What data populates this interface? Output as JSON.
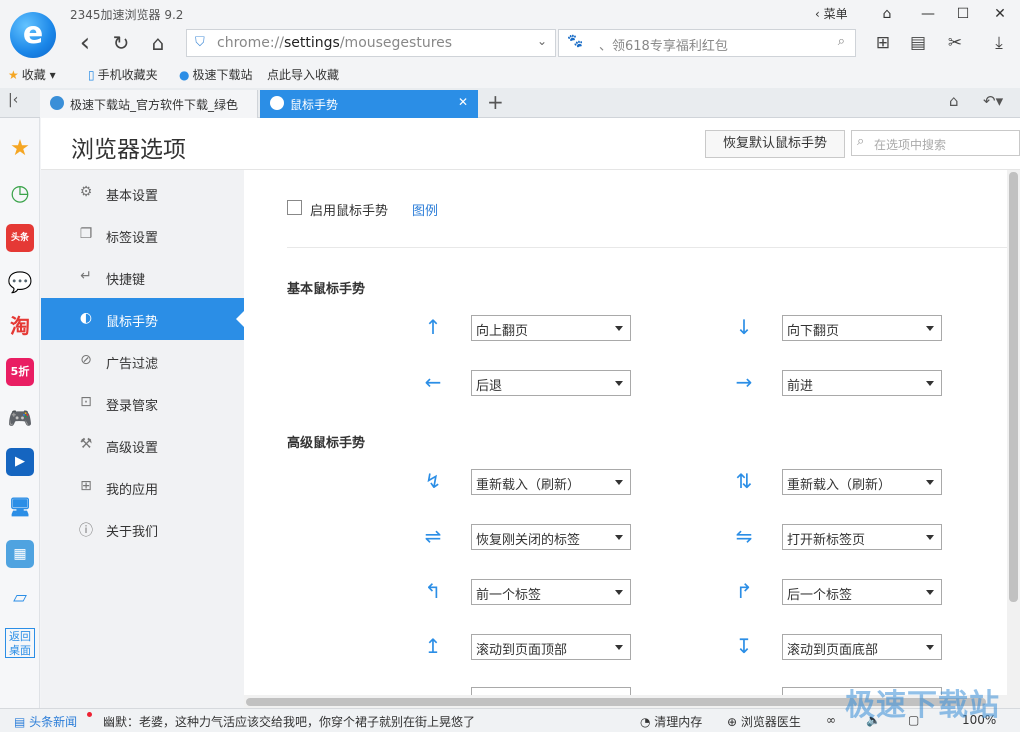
{
  "titlebar": {
    "logo_glyph": "e",
    "title": "2345加速浏览器 9.2",
    "menu_label": "菜单",
    "minimize": "—",
    "maximize": "☐",
    "close": "✕",
    "back": "‹",
    "reload": "↻",
    "home": "⌂"
  },
  "address": {
    "url_prefix": "chrome://",
    "url_host": "settings",
    "url_path": "/mousegestures",
    "search_placeholder": "、领618专享福利红包"
  },
  "bookmarks": {
    "items": [
      "收藏",
      "手机收藏夹",
      "极速下载站",
      "点此导入收藏"
    ]
  },
  "tabs": [
    {
      "label": "极速下载站_官方软件下载_绿色",
      "active": false
    },
    {
      "label": "鼠标手势",
      "active": true
    }
  ],
  "appbar": {
    "icons": [
      "star-icon",
      "clock-icon",
      "toutiao-icon",
      "wechat-icon",
      "taobao-icon",
      "discount-icon",
      "game-icon",
      "video-icon",
      "computer-icon",
      "calculator-icon",
      "notebook-icon"
    ],
    "taobao_glyph": "淘",
    "discount_glyph": "5折",
    "toutiao_glyph": "头条",
    "back_desktop": "返回桌面"
  },
  "settings": {
    "page_title": "浏览器选项",
    "reset_button": "恢复默认鼠标手势",
    "search_placeholder": "在选项中搜索",
    "nav": [
      {
        "label": "基本设置",
        "icon": "gear-icon",
        "glyph": "⚙"
      },
      {
        "label": "标签设置",
        "icon": "tab-icon",
        "glyph": "❐"
      },
      {
        "label": "快捷键",
        "icon": "keyboard-icon",
        "glyph": "↵"
      },
      {
        "label": "鼠标手势",
        "icon": "mouse-icon",
        "glyph": "◐"
      },
      {
        "label": "广告过滤",
        "icon": "block-icon",
        "glyph": "⊘"
      },
      {
        "label": "登录管家",
        "icon": "lock-icon",
        "glyph": "🔒"
      },
      {
        "label": "高级设置",
        "icon": "wrench-icon",
        "glyph": "🔧"
      },
      {
        "label": "我的应用",
        "icon": "apps-icon",
        "glyph": "⊞"
      },
      {
        "label": "关于我们",
        "icon": "info-icon",
        "glyph": "ⓘ"
      }
    ],
    "active_nav": 3,
    "enable_label": "启用鼠标手势",
    "enable_checked": false,
    "legend_link": "图例",
    "basic_title": "基本鼠标手势",
    "advanced_title": "高级鼠标手势",
    "basic_gestures": [
      {
        "arrow": "↑",
        "icon": "arrow-up-icon",
        "action": "向上翻页"
      },
      {
        "arrow": "↓",
        "icon": "arrow-down-icon",
        "action": "向下翻页"
      },
      {
        "arrow": "←",
        "icon": "arrow-left-icon",
        "action": "后退"
      },
      {
        "arrow": "→",
        "icon": "arrow-right-icon",
        "action": "前进"
      }
    ],
    "advanced_gestures": [
      {
        "arrow": "↯",
        "icon": "up-down-gesture-icon",
        "action": "重新载入（刷新）"
      },
      {
        "arrow": "⇅",
        "icon": "down-up-gesture-icon",
        "action": "重新载入（刷新）"
      },
      {
        "arrow": "⇌",
        "icon": "right-left-gesture-icon",
        "action": "恢复刚关闭的标签"
      },
      {
        "arrow": "⇋",
        "icon": "left-right-gesture-icon",
        "action": "打开新标签页"
      },
      {
        "arrow": "↰",
        "icon": "up-left-gesture-icon",
        "action": "前一个标签"
      },
      {
        "arrow": "↱",
        "icon": "up-right-gesture-icon",
        "action": "后一个标签"
      },
      {
        "arrow": "↥",
        "icon": "left-up-gesture-icon",
        "action": "滚动到页面顶部"
      },
      {
        "arrow": "↧",
        "icon": "right-down-gesture-icon",
        "action": "滚动到页面底部"
      }
    ]
  },
  "statusbar": {
    "news": "头条新闻",
    "ticker": "幽默：老婆，这种力气活应该交给我吧，你穿个裙子就别在街上晃悠了",
    "clean_memory": "清理内存",
    "doctor": "浏览器医生",
    "zoom": "100%"
  },
  "watermark": "极速下载站",
  "colors": {
    "accent": "#2b8ee6",
    "link": "#2b7dd8"
  }
}
